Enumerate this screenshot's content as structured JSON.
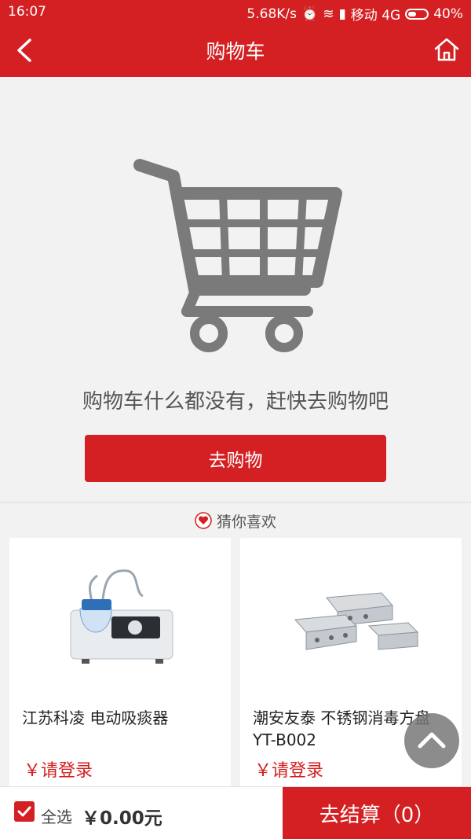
{
  "status_bar": {
    "time": "16:07",
    "speed": "5.68K/s",
    "carrier": "移动 4G",
    "battery": "40%"
  },
  "header": {
    "title": "购物车",
    "back_icon": "chevron-left-icon",
    "home_icon": "home-icon"
  },
  "empty_cart": {
    "icon": "shopping-cart-icon",
    "message": "购物车什么都没有，赶快去购物吧",
    "button_label": "去购物"
  },
  "recommend": {
    "title": "猜你喜欢",
    "icon": "heart-icon",
    "items": [
      {
        "name": "江苏科凌 电动吸痰器",
        "price": "￥请登录",
        "image": "suction-machine-image"
      },
      {
        "name": "潮安友泰 不锈钢消毒方盘 YT-B002",
        "price": "￥请登录",
        "image": "steel-trays-image"
      }
    ]
  },
  "bottom_bar": {
    "select_all": "全选",
    "total": "￥0.00元",
    "checkout": "去结算（0）"
  },
  "colors": {
    "brand": "#d42022",
    "background": "#f2f2f2",
    "icon_gray": "#7a7a7a"
  }
}
